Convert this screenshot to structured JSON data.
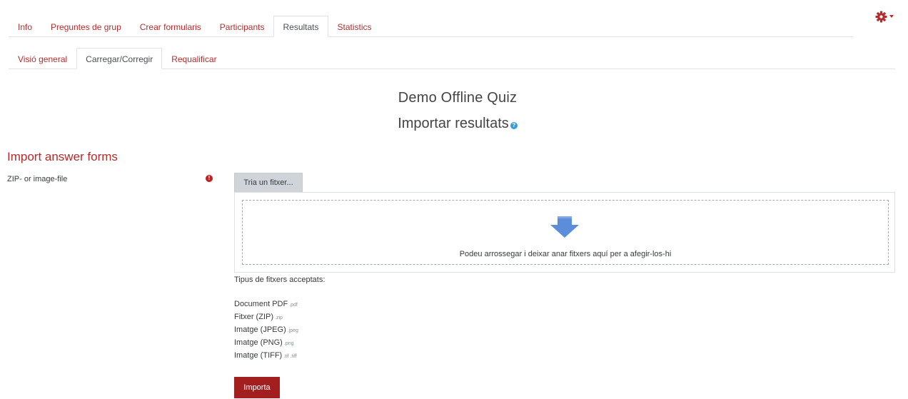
{
  "tabs_primary": [
    {
      "label": "Info",
      "active": false
    },
    {
      "label": "Preguntes de grup",
      "active": false
    },
    {
      "label": "Crear formularis",
      "active": false
    },
    {
      "label": "Participants",
      "active": false
    },
    {
      "label": "Resultats",
      "active": true
    },
    {
      "label": "Statistics",
      "active": false
    }
  ],
  "tabs_secondary": [
    {
      "label": "Visió general",
      "active": false
    },
    {
      "label": "Carregar/Corregir",
      "active": true
    },
    {
      "label": "Requalificar",
      "active": false
    }
  ],
  "header": {
    "title": "Demo Offline Quiz",
    "subtitle": "Importar resultats",
    "help_icon": "question-circle-icon",
    "settings_icon": "gear-icon"
  },
  "form": {
    "section_title": "Import answer forms",
    "field_label": "ZIP- or image-file",
    "required_icon": "exclamation-circle-icon",
    "choose_button": "Tria un fitxer...",
    "drop_text": "Podeu arrossegar i deixar anar fitxers aquí per a afegir-los-hi",
    "accepted_label": "Tipus de fitxers acceptats:",
    "file_types": [
      {
        "name": "Document PDF",
        "ext": ".pdf"
      },
      {
        "name": "Fitxer (ZIP)",
        "ext": ".zip"
      },
      {
        "name": "Imatge (JPEG)",
        "ext": ".jpeg"
      },
      {
        "name": "Imatge (PNG)",
        "ext": ".png"
      },
      {
        "name": "Imatge (TIFF)",
        "ext": ".tif .tiff"
      }
    ],
    "import_button": "Importa"
  },
  "colors": {
    "accent": "#b52c2c",
    "button_primary": "#a31f1f",
    "drop_arrow": "#5b8ddb",
    "help": "#3b9ad9"
  }
}
